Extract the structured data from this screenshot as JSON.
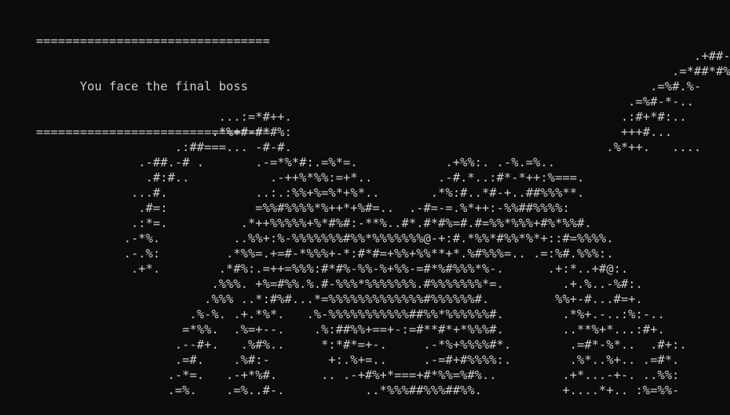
{
  "terminal": {
    "header": {
      "top_rule": "================================",
      "title": "      You face the final boss",
      "bottom_rule": "================================"
    },
    "art": "                                                                                          .+##-.\n                                                                                       .=*##*#%*:\n                                                                                    .=%#.%-     .*:%..\n                                                                                 .=%#-*-..       .**%#.\n                         ...:=*#++.                                             .:#+*#:..           .+%+.\n                        .*%+#-#*#%:                                             +++#...            ..#..\n                   .:##===... -#-#.                                           .%*++.   ....\n              .-##.-# .       .-=*%*#:.=%*=.            .+%%:. .-%.=%..\n               .#:#..           .-++%*%%:=+*..         .-#.*..:#*-*++:%===.\n             ...#.            ..:.:%%+%=%*+%*..       .*%:#..*#-+..##%%%**.\n              .#=:            =%%#%%%%*%++*+%#=..  .-#=-=.%*++:-%%##%%%%:\n             .:*=.          .*++%%%%%+%*#%#:-**%..#*.#*#%=#.#=%%*%%%+#%*%%#.\n            .-*%.          ..%%+:%-%%%%%%%#%%*%%%%%%%@-+:#.*%%*#%%*%*+::#=%%%%.\n            .-.%:         .*%%=.+=#-*%%%+-*:#*#=+%%+%%**+*.%#%%%=.. .=:%#.%%%:.\n             .+*.        .*#%:.=++=%%%:#*#%-%%-%+%%-=#*%#%%%*%-.      .+:*..+#@:.\n                        .%%%. +%=#%%.%.#-%%%*%%%%%%%.#%%%%%%%*=.        .+.%..-%#:.\n                       .%%% ..*:#%#...*=%%%%%%%%%%%%%#%%%%%%#.         %%+-#...#=+.\n                     .%-%. .+.*%*.   .%-%%%%%%%%%%%##%%*%%%%%%#.        .*%+.-..:%:-..\n                    =*%%.  .%=+--.    .%:##%%+==+-:=#**#*+*%%%#.        ..**%+*...:#+.\n                   .--#+.   .%#%..     *:*#*=+-.     .-*%+%%%%#*.        .=#*-%*..  .#+:.\n                   .=#.    .%#:-        +:.%+=..     .-=#+#%%%%:.        .%*..%+.. .=#*.\n                  .-*=.   .-+*%#.      .. .-+#%+*===+#*%%=%#%..         .+*...-+-. ..%%:\n                  .=%.    .=%..#-.           ..*%%%##%%%##%%.           +....*+.. :%=%%-"
  }
}
